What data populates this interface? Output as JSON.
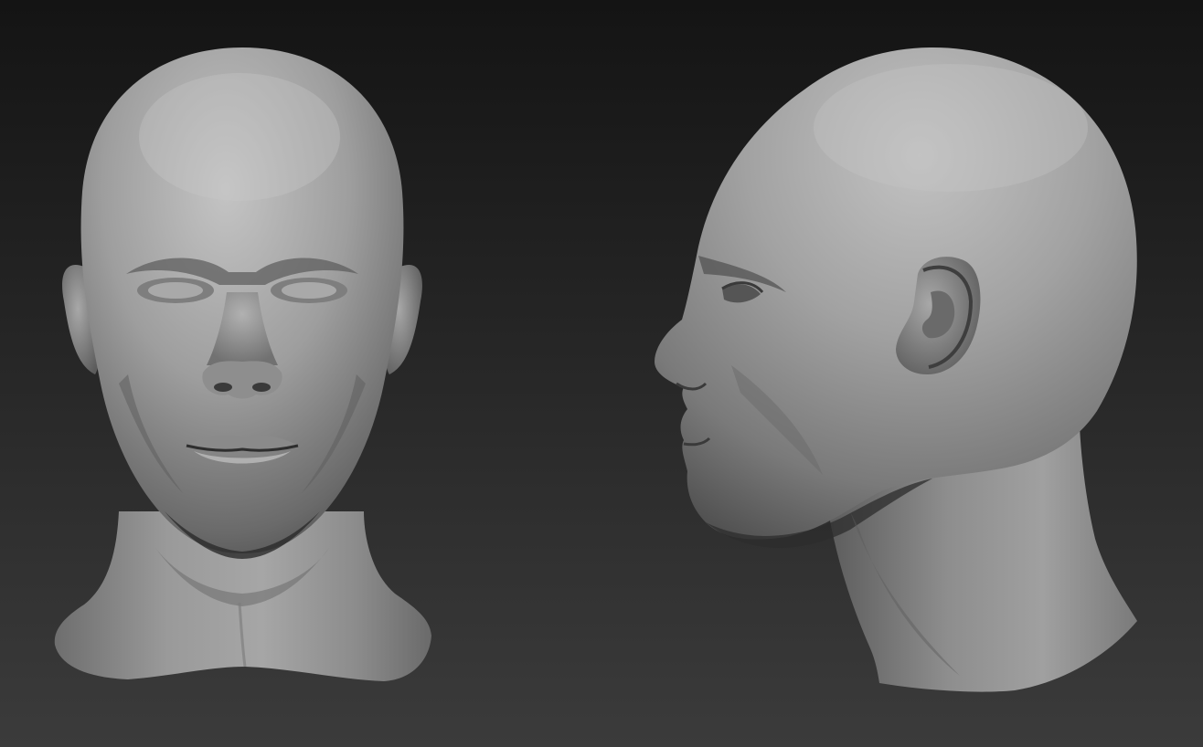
{
  "scene": {
    "background_top": "#141414",
    "background_bottom": "#3b3b3b",
    "material_light": "#c2c2c2",
    "material_mid": "#8a8a8a",
    "material_dark": "#3e3e3e",
    "material_shadow": "#1c1c1c"
  },
  "views": [
    {
      "view": "front"
    },
    {
      "view": "side-profile"
    }
  ]
}
